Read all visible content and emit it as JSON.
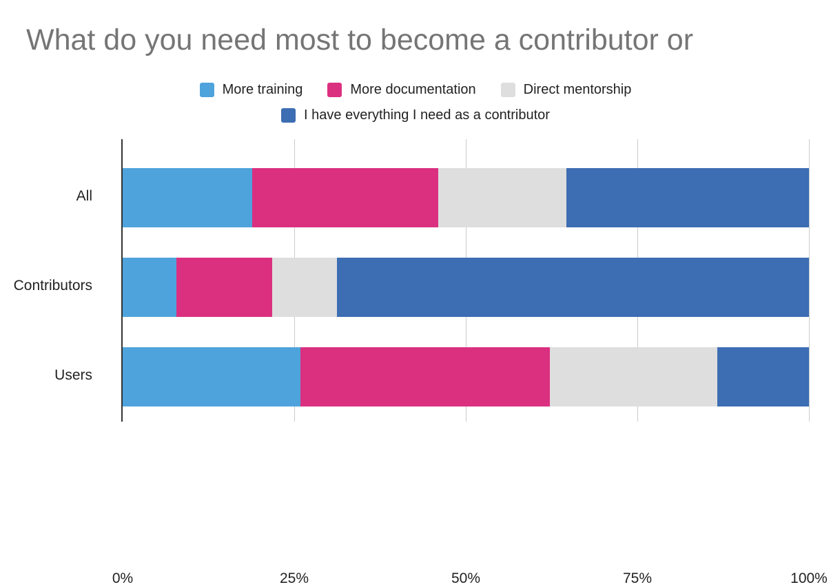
{
  "chart_data": {
    "type": "bar",
    "orientation": "horizontal",
    "stacked": true,
    "stack_mode": "percent",
    "title": "What do you need most to become a contributor or",
    "xlabel": "",
    "ylabel": "",
    "xlim": [
      0,
      100
    ],
    "xticks": [
      "0%",
      "25%",
      "50%",
      "75%",
      "100%"
    ],
    "xtick_values": [
      0,
      25,
      50,
      75,
      100
    ],
    "grid": true,
    "legend_position": "top",
    "categories": [
      "All",
      "Contributors",
      "Users"
    ],
    "series": [
      {
        "name": "More training",
        "color": "#4fa3dc",
        "values": [
          18.9,
          7.8,
          25.9
        ]
      },
      {
        "name": "More documentation",
        "color": "#db3080",
        "values": [
          27.1,
          14.0,
          36.3
        ]
      },
      {
        "name": "Direct mentorship",
        "color": "#dedede",
        "values": [
          18.7,
          9.4,
          24.4
        ]
      },
      {
        "name": "I have everything I need as a contributor",
        "color": "#3d6db3",
        "values": [
          35.3,
          68.8,
          13.4
        ]
      }
    ]
  },
  "legend": {
    "row1": [
      {
        "label": "More training",
        "color": "#4fa3dc"
      },
      {
        "label": "More documentation",
        "color": "#db3080"
      },
      {
        "label": "Direct mentorship",
        "color": "#dedede"
      }
    ],
    "row2": [
      {
        "label": "I have everything I need as a contributor",
        "color": "#3d6db3"
      }
    ]
  },
  "colors": {
    "title": "#757575",
    "axis": "#333333",
    "grid": "#cccccc",
    "text": "#222222",
    "background": "#ffffff"
  }
}
